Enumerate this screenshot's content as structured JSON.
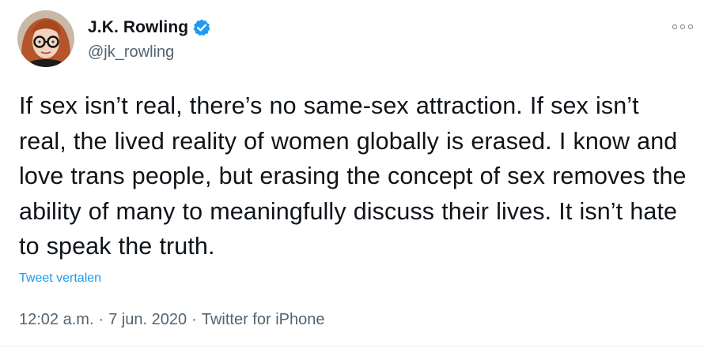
{
  "author": {
    "display_name": "J.K. Rowling",
    "handle": "@jk_rowling",
    "verified": true,
    "avatar_icon": "avatar-photo"
  },
  "menu": {
    "icon": "more-options-icon"
  },
  "tweet": {
    "text": "If sex isn’t real, there’s no same-sex attraction. If sex isn’t real, the lived reality of women globally is erased. I know and love trans people, but erasing the concept of sex removes the ability of many to meaningfully discuss their lives. It isn’t hate to speak the truth.",
    "translate_label": "Tweet vertalen"
  },
  "meta": {
    "time": "12:02 a.m.",
    "separator": "·",
    "date": "7 jun. 2020",
    "source": "Twitter for iPhone"
  },
  "colors": {
    "text": "#0f1419",
    "secondary": "#536471",
    "accent": "#1d9bf0",
    "verified": "#1d9bf0"
  }
}
